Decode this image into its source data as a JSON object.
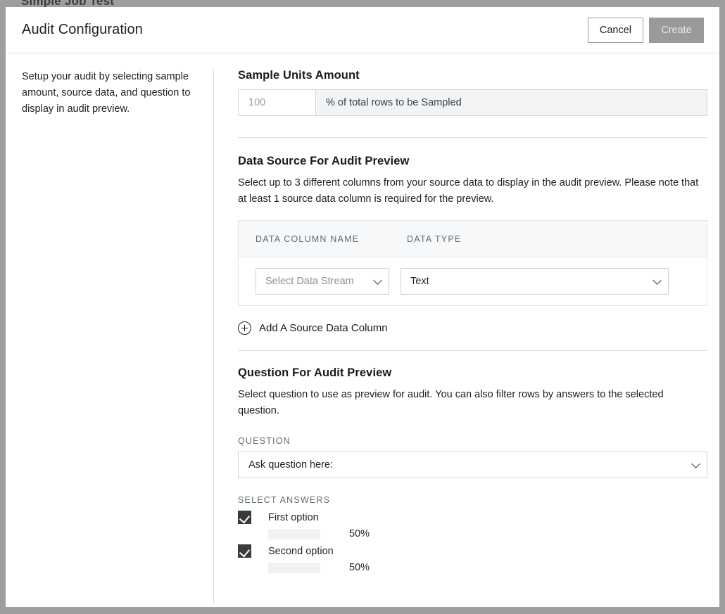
{
  "background": {
    "page_title": "Simple Job Test"
  },
  "modal": {
    "title": "Audit Configuration",
    "cancel_label": "Cancel",
    "create_label": "Create",
    "side_description": "Setup your audit by selecting sample amount, source data, and question to display in audit preview."
  },
  "sample_units": {
    "title": "Sample Units Amount",
    "input_placeholder": "100",
    "input_value": "",
    "suffix_label": "% of total rows to be Sampled"
  },
  "data_source": {
    "title": "Data Source For Audit Preview",
    "description": "Select up to 3 different columns from your source data to display in the audit preview. Please note that at least 1 source data column is required for the preview.",
    "columns": [
      "DATA COLUMN NAME",
      "DATA TYPE"
    ],
    "rows": [
      {
        "column_name_value": "Select Data Stream",
        "data_type_value": "Text"
      }
    ],
    "add_label": "Add A Source Data Column"
  },
  "question_section": {
    "title": "Question For Audit Preview",
    "description": "Select question to use as preview for audit. You can also filter rows by answers to the selected question.",
    "question_label": "QUESTION",
    "question_value": "Ask question here:",
    "answers_label": "SELECT ANSWERS",
    "answers": [
      {
        "label": "First option",
        "percent_label": "50%",
        "percent": 50,
        "checked": true
      },
      {
        "label": "Second option",
        "percent_label": "50%",
        "percent": 50,
        "checked": true
      }
    ]
  },
  "colors": {
    "accent_bar": "#0a3b47",
    "bar_track": "#f1f2f3",
    "disabled_button": "#9a9a9a",
    "checkbox": "#3a3a3a",
    "page_backdrop": "#9e9e9e"
  }
}
